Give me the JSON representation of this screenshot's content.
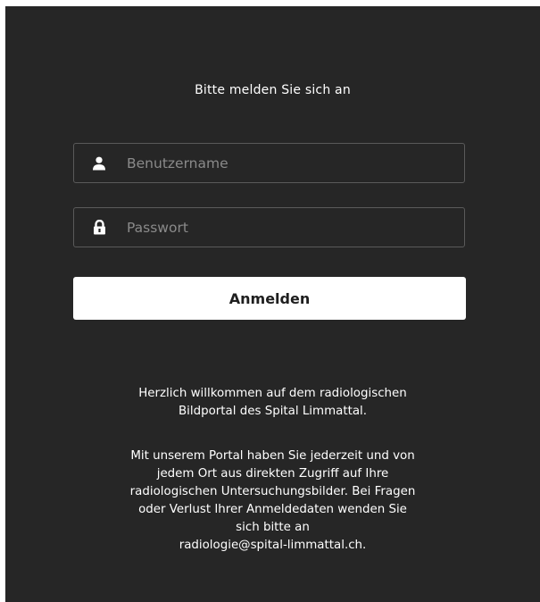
{
  "login": {
    "heading": "Bitte melden Sie sich an",
    "username_placeholder": "Benutzername",
    "username_value": "",
    "password_placeholder": "Passwort",
    "password_value": "",
    "submit_label": "Anmelden",
    "icons": {
      "username": "user-icon",
      "password": "lock-icon"
    }
  },
  "info": {
    "welcome_lines": [
      "Herzlich willkommen auf dem radiologischen",
      "Bildportal des Spital Limmattal."
    ],
    "help_lines": [
      "Mit unserem Portal haben Sie jederzeit und von",
      "jedem Ort aus direkten Zugriff auf Ihre",
      "radiologischen Untersuchungsbilder. Bei Fragen",
      "oder Verlust Ihrer Anmeldedaten wenden Sie",
      "sich bitte an",
      "radiologie@spital-limmattal.ch."
    ]
  },
  "colors": {
    "background": "#262626",
    "text": "#ffffff",
    "field_border": "#5a5a5a",
    "placeholder": "#8a8a8a",
    "button_bg": "#ffffff",
    "button_text": "#1f1f1f"
  }
}
